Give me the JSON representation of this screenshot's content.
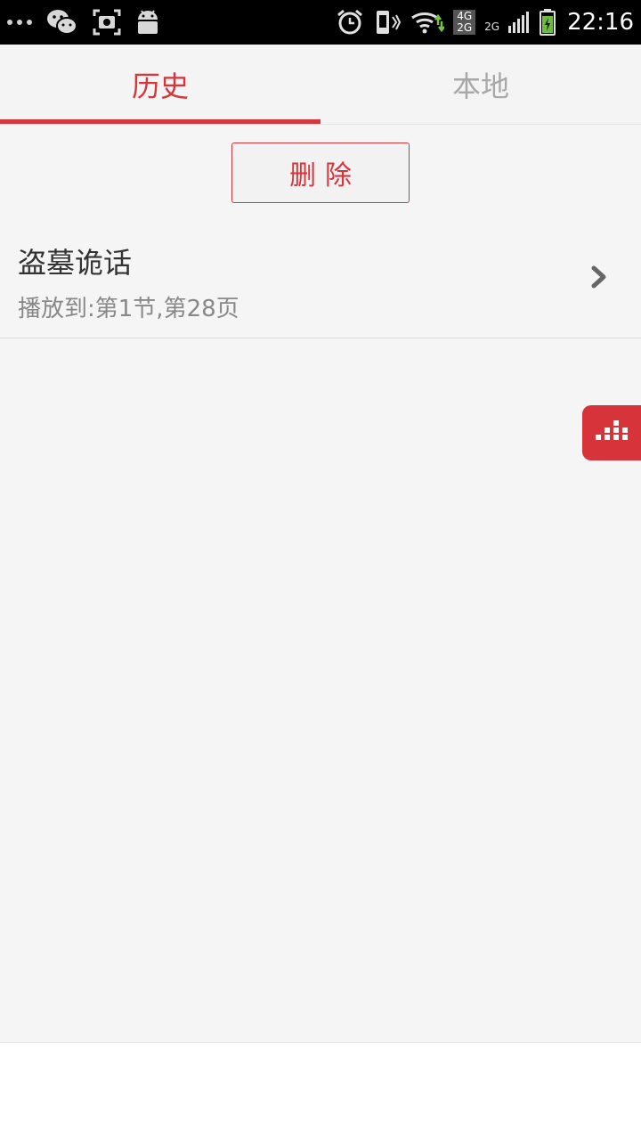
{
  "status_bar": {
    "time": "22:16",
    "network_4g": "4G",
    "network_2g": "2G",
    "network_2g_small": "2G",
    "icons": [
      "more-dots-icon",
      "wechat-icon",
      "screenshot-icon",
      "android-icon",
      "alarm-icon",
      "vibrate-icon",
      "wifi-icon",
      "signal-icon",
      "battery-icon"
    ]
  },
  "tabs": [
    {
      "label": "历史",
      "active": true
    },
    {
      "label": "本地",
      "active": false
    }
  ],
  "toolbar": {
    "delete_label": "删除"
  },
  "history": [
    {
      "title": "盗墓诡话",
      "progress": "播放到:第1节,第28页"
    }
  ],
  "colors": {
    "accent": "#d8353a",
    "tab_inactive": "#a8a8a8",
    "background": "#f5f5f5"
  }
}
